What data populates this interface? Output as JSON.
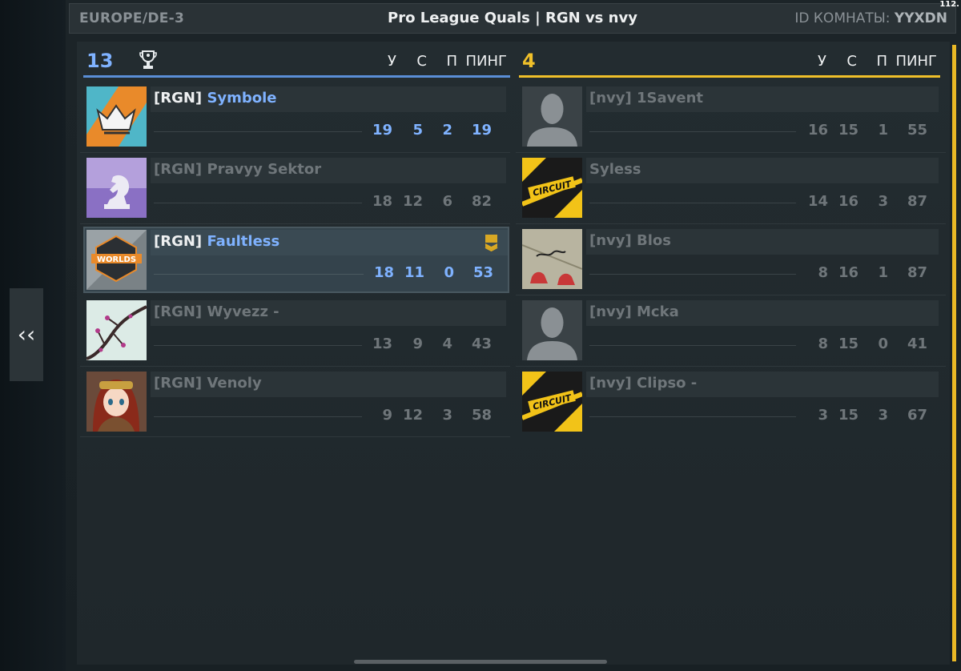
{
  "header": {
    "server": "EUROPE/DE-3",
    "match_title": "Pro League Quals | RGN vs nvy",
    "room_label": "ID КОМНАТЫ:",
    "room_id": "YYXDN",
    "fps": "112."
  },
  "columns": {
    "k": "У",
    "d": "С",
    "a": "П",
    "ping": "ПИНГ"
  },
  "team_left": {
    "score": "13",
    "color": "#5a8ed6",
    "players": [
      {
        "tag": "[RGN]",
        "name": "Symbole",
        "k": "19",
        "d": "5",
        "a": "2",
        "ping": "19",
        "avatar": "crown-logo-icon"
      },
      {
        "tag": "[RGN]",
        "name": "Pravyy Sektor",
        "k": "18",
        "d": "12",
        "a": "6",
        "ping": "82",
        "avatar": "chess-knight-icon"
      },
      {
        "tag": "[RGN]",
        "name": "Faultless",
        "k": "18",
        "d": "11",
        "a": "0",
        "ping": "53",
        "avatar": "worlds-logo-icon"
      },
      {
        "tag": "[RGN]",
        "name": "Wyvezz -",
        "k": "13",
        "d": "9",
        "a": "4",
        "ping": "43",
        "avatar": "cherry-branch-icon"
      },
      {
        "tag": "[RGN]",
        "name": "Venoly",
        "k": "9",
        "d": "12",
        "a": "3",
        "ping": "58",
        "avatar": "anime-girl-icon"
      }
    ]
  },
  "team_right": {
    "score": "4",
    "color": "#f0c02a",
    "players": [
      {
        "tag": "[nvy]",
        "name": "1Savent",
        "k": "16",
        "d": "15",
        "a": "1",
        "ping": "55",
        "avatar": "default-silhouette-icon"
      },
      {
        "tag": "",
        "name": "Syless",
        "k": "14",
        "d": "16",
        "a": "3",
        "ping": "87",
        "avatar": "circuit-logo-icon"
      },
      {
        "tag": "[nvy]",
        "name": "Blos",
        "k": "8",
        "d": "16",
        "a": "1",
        "ping": "87",
        "avatar": "look-up-sneakers-icon"
      },
      {
        "tag": "[nvy]",
        "name": "Mcka",
        "k": "8",
        "d": "15",
        "a": "0",
        "ping": "41",
        "avatar": "default-silhouette-icon"
      },
      {
        "tag": "[nvy]",
        "name": "Clipso -",
        "k": "3",
        "d": "15",
        "a": "3",
        "ping": "67",
        "avatar": "circuit-logo-icon"
      }
    ]
  },
  "nav": {
    "back": "‹‹"
  }
}
